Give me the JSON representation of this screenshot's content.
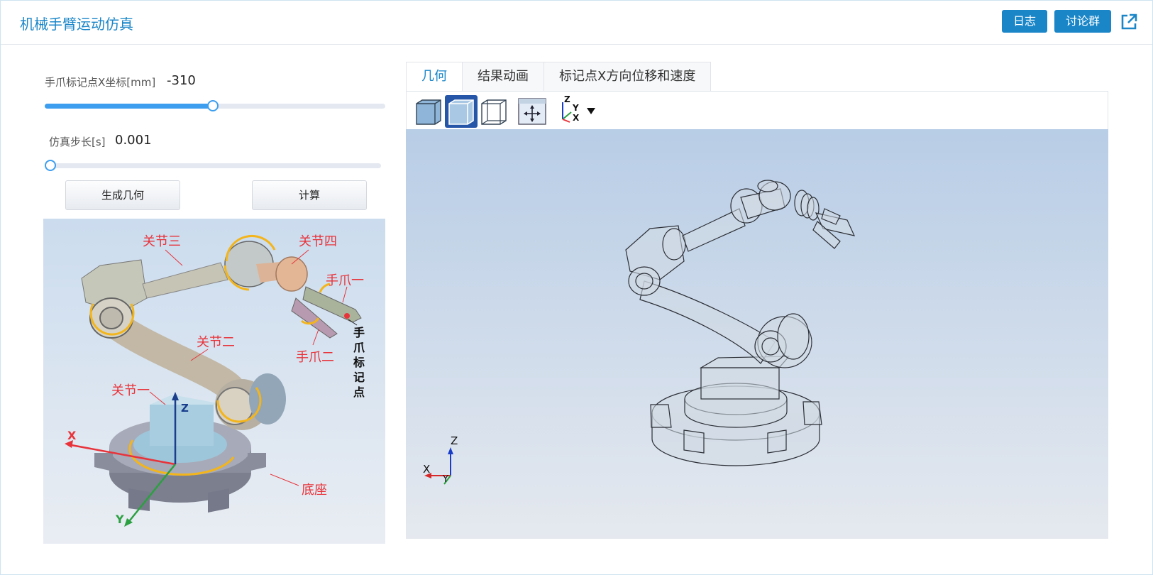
{
  "header": {
    "title": "机械手臂运动仿真",
    "log_label": "日志",
    "discussion_label": "讨论群",
    "external_link_icon": "external-link-icon"
  },
  "params": {
    "x_coord": {
      "label": "手爪标记点X坐标[mm]",
      "value": "-310",
      "slider_fraction": 0.5
    },
    "step": {
      "label": "仿真步长[s]",
      "value": "0.001",
      "slider_fraction": 0.0
    }
  },
  "buttons": {
    "generate": "生成几何",
    "compute": "计算"
  },
  "diagram": {
    "labels": {
      "joint3": "关节三",
      "joint4": "关节四",
      "claw1": "手爪一",
      "joint2": "关节二",
      "claw2": "手爪二",
      "joint1": "关节一",
      "marker": "手爪标记点",
      "base": "底座",
      "axis_x": "X",
      "axis_y": "Y",
      "axis_z": "Z"
    }
  },
  "tabs": [
    {
      "label": "几何",
      "active": true
    },
    {
      "label": "结果动画",
      "active": false
    },
    {
      "label": "标记点X方向位移和速度",
      "active": false
    }
  ],
  "toolbar": {
    "tools": [
      "shaded-view-icon",
      "shaded-edges-view-icon",
      "wireframe-view-icon",
      "fit-view-icon",
      "axis-orientation-icon"
    ],
    "active_tool": "shaded-edges-view-icon",
    "axis_labels": {
      "z": "Z",
      "y": "Y",
      "x": "X"
    }
  },
  "viewport": {
    "axis_labels": {
      "z": "Z",
      "x": "X",
      "y": "Y"
    }
  },
  "colors": {
    "accent": "#1a86c8",
    "slider": "#3d9ef0",
    "label_red": "#e8333a",
    "active_tool": "#2556a8"
  }
}
